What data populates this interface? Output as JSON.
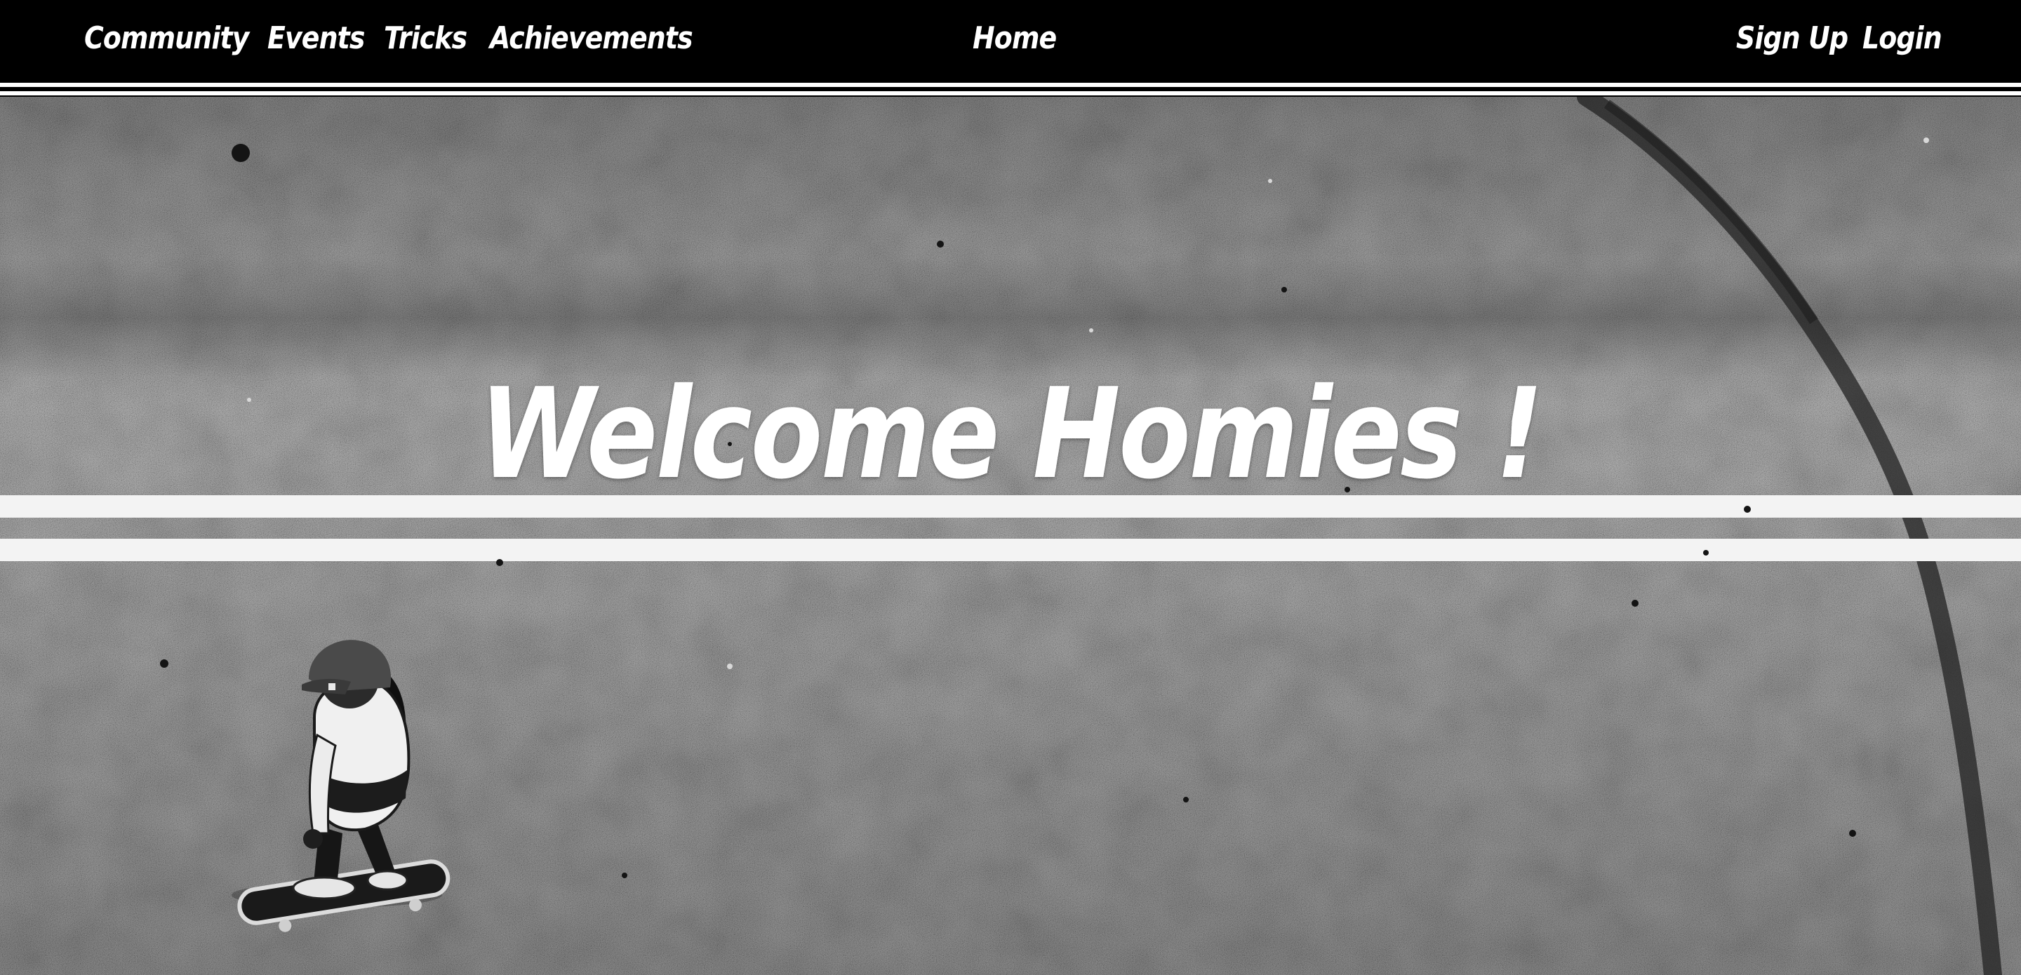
{
  "nav": {
    "left_links": [
      "Community",
      "Events",
      "Tricks",
      "Achievements"
    ],
    "center_link": "Home",
    "right_links": [
      "Sign Up",
      "Login"
    ]
  },
  "hero": {
    "title": "Welcome Homies !",
    "image_subject": "skateboarder-on-asphalt-road"
  },
  "colors": {
    "nav_background": "#000000",
    "nav_text": "#ffffff",
    "asphalt": "#5e5e5e",
    "road_marking": "#f4f4f4"
  }
}
